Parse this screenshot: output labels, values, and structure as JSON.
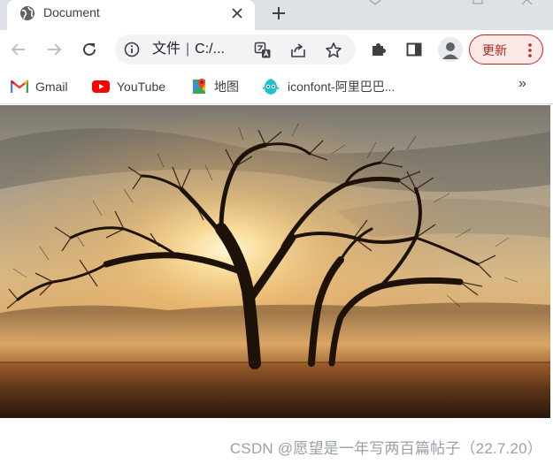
{
  "tab": {
    "title": "Document"
  },
  "omnibox": {
    "file_label": "文件",
    "separator": "|",
    "path": "C:/..."
  },
  "toolbar": {
    "update_label": "更新"
  },
  "bookmarks": [
    {
      "label": "Gmail",
      "icon": "gmail-icon"
    },
    {
      "label": "YouTube",
      "icon": "youtube-icon"
    },
    {
      "label": "地图",
      "icon": "maps-icon"
    },
    {
      "label": "iconfont-阿里巴巴...",
      "icon": "iconfont-icon"
    }
  ],
  "bookmarks_more": "»",
  "watermark": "CSDN @愿望是一年写两百篇帖子（22.7.20）",
  "colors": {
    "accent_update": "#c5221f",
    "tabstrip": "#dee1e6",
    "omnibox": "#f1f3f4"
  }
}
